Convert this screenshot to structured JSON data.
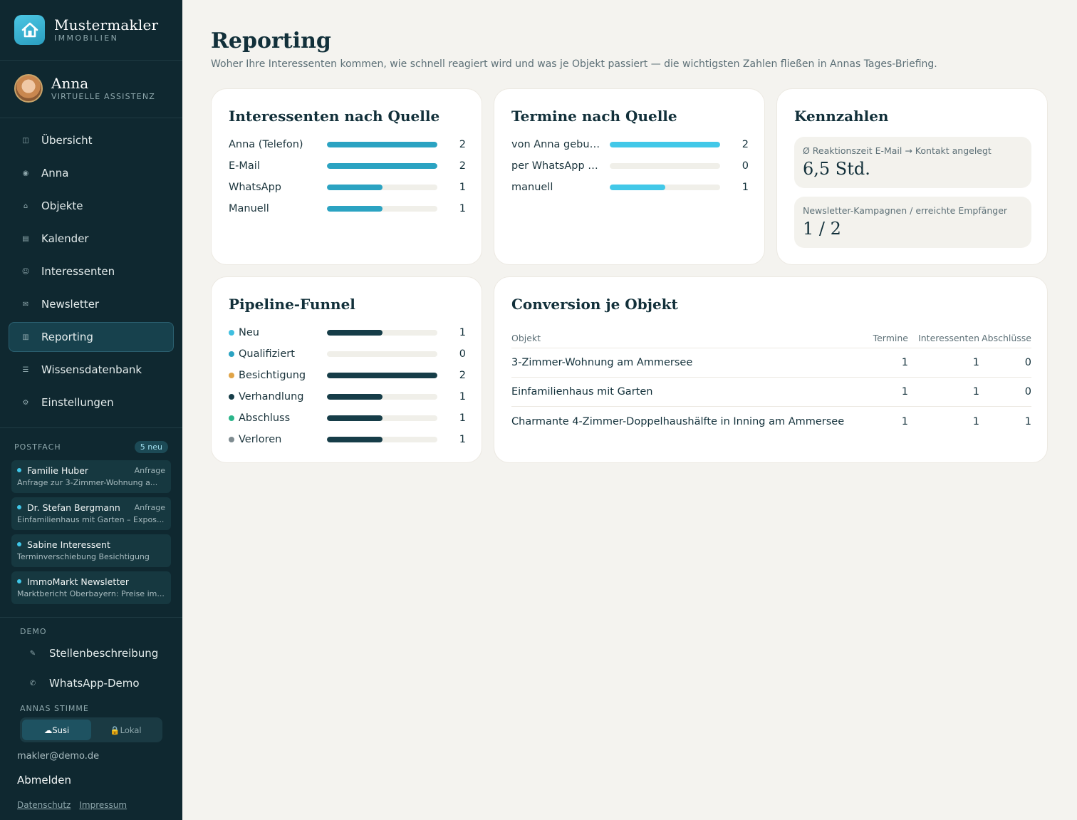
{
  "brand": {
    "name": "Mustermakler",
    "sub": "IMMOBILIEN"
  },
  "profile": {
    "name": "Anna",
    "role": "VIRTUELLE ASSISTENZ"
  },
  "nav": [
    {
      "label": "Übersicht",
      "icon": "grid-icon",
      "active": false
    },
    {
      "label": "Anna",
      "icon": "circle-icon",
      "active": false
    },
    {
      "label": "Objekte",
      "icon": "house-icon",
      "active": false
    },
    {
      "label": "Kalender",
      "icon": "calendar-icon",
      "active": false
    },
    {
      "label": "Interessenten",
      "icon": "smiley-icon",
      "active": false
    },
    {
      "label": "Newsletter",
      "icon": "mail-icon",
      "active": false
    },
    {
      "label": "Reporting",
      "icon": "bar-chart-icon",
      "active": true
    },
    {
      "label": "Wissensdatenbank",
      "icon": "list-icon",
      "active": false
    },
    {
      "label": "Einstellungen",
      "icon": "gear-icon",
      "active": false
    }
  ],
  "postfach": {
    "title": "POSTFACH",
    "badge": "5 neu",
    "items": [
      {
        "from": "Familie Huber",
        "tag": "Anfrage",
        "subject": "Anfrage zur 3-Zimmer-Wohnung a..."
      },
      {
        "from": "Dr. Stefan Bergmann",
        "tag": "Anfrage",
        "subject": "Einfamilienhaus mit Garten – Expos..."
      },
      {
        "from": "Sabine Interessent",
        "tag": "",
        "subject": "Terminverschiebung Besichtigung"
      },
      {
        "from": "ImmoMarkt Newsletter",
        "tag": "",
        "subject": "Marktbericht Oberbayern: Preise im..."
      }
    ]
  },
  "demo": {
    "label": "DEMO",
    "items": [
      {
        "label": "Stellenbeschreibung",
        "icon": "pencil-icon"
      },
      {
        "label": "WhatsApp-Demo",
        "icon": "phone-icon"
      }
    ]
  },
  "voice": {
    "label": "ANNAS STIMME",
    "options": [
      "☁Susi",
      "🔒Lokal"
    ],
    "active": 0
  },
  "user": {
    "email": "makler@demo.de",
    "logout": "Abmelden"
  },
  "legal": {
    "datenschutz": "Datenschutz",
    "impressum": "Impressum"
  },
  "page": {
    "title": "Reporting",
    "subtitle": "Woher Ihre Interessenten kommen, wie schnell reagiert wird und was je Objekt passiert — die wichtigsten Zahlen fließen in Annas Tages-Briefing."
  },
  "colors": {
    "teal": "#2ba3c2",
    "cyan": "#42c8e8",
    "dark": "#163d48",
    "track": "#f0efe9"
  },
  "interessenten": {
    "title": "Interessenten nach Quelle",
    "max": 2,
    "rows": [
      {
        "label": "Anna (Telefon)",
        "value": 2
      },
      {
        "label": "E-Mail",
        "value": 2
      },
      {
        "label": "WhatsApp",
        "value": 1
      },
      {
        "label": "Manuell",
        "value": 1
      }
    ]
  },
  "termine": {
    "title": "Termine nach Quelle",
    "max": 2,
    "rows": [
      {
        "label": "von Anna gebucht",
        "value": 2
      },
      {
        "label": "per WhatsApp d...",
        "value": 0
      },
      {
        "label": "manuell",
        "value": 1
      }
    ]
  },
  "kennzahlen": {
    "title": "Kennzahlen",
    "items": [
      {
        "label": "Ø Reaktionszeit E-Mail → Kontakt angelegt",
        "value": "6,5 Std."
      },
      {
        "label": "Newsletter-Kampagnen / erreichte Empfänger",
        "value": "1 / 2"
      }
    ]
  },
  "pipeline": {
    "title": "Pipeline-Funnel",
    "max": 2,
    "rows": [
      {
        "label": "Neu",
        "value": 1,
        "dot": "#3fbfe0"
      },
      {
        "label": "Qualifiziert",
        "value": 0,
        "dot": "#2ba3c2"
      },
      {
        "label": "Besichtigung",
        "value": 2,
        "dot": "#e0a447"
      },
      {
        "label": "Verhandlung",
        "value": 1,
        "dot": "#163d48"
      },
      {
        "label": "Abschluss",
        "value": 1,
        "dot": "#2bb58a"
      },
      {
        "label": "Verloren",
        "value": 1,
        "dot": "#7e8b90"
      }
    ]
  },
  "conversion": {
    "title": "Conversion je Objekt",
    "headers": [
      "Objekt",
      "Termine",
      "Interessenten",
      "Abschlüsse"
    ],
    "rows": [
      {
        "objekt": "3-Zimmer-Wohnung am Ammersee",
        "termine": "1",
        "interessenten": "1",
        "abschluesse": "0"
      },
      {
        "objekt": "Einfamilienhaus mit Garten",
        "termine": "1",
        "interessenten": "1",
        "abschluesse": "0"
      },
      {
        "objekt": "Charmante 4-Zimmer-Doppelhaushälfte in Inning am Ammersee",
        "termine": "1",
        "interessenten": "1",
        "abschluesse": "1"
      }
    ]
  }
}
